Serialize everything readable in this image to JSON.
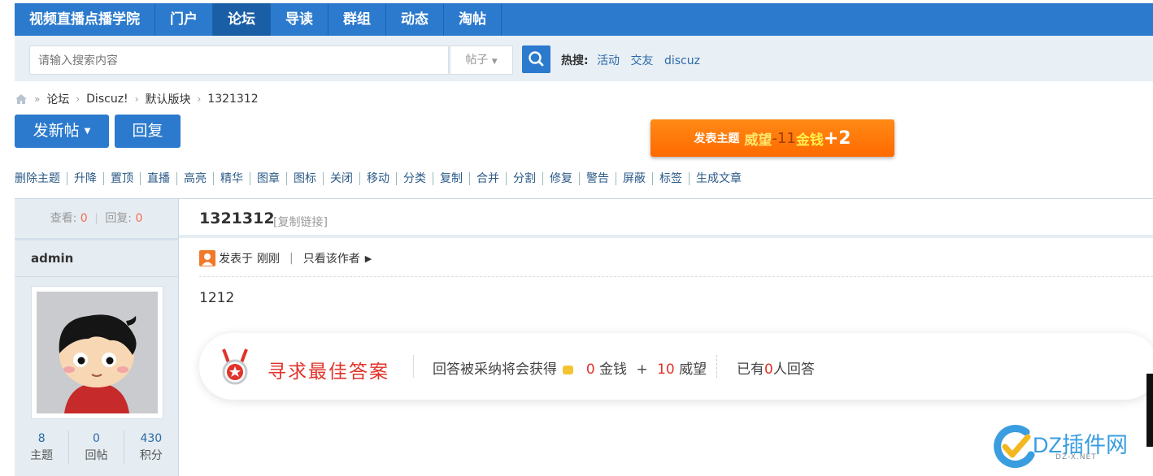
{
  "nav": {
    "site": "视频直播点播学院",
    "items": [
      "门户",
      "论坛",
      "导读",
      "群组",
      "动态",
      "淘帖"
    ],
    "active": 1
  },
  "search": {
    "placeholder": "请输入搜索内容",
    "type": "帖子",
    "hot_label": "热搜:",
    "hot": [
      "活动",
      "交友",
      "discuz"
    ]
  },
  "breadcrumb": [
    "论坛",
    "Discuz!",
    "默认版块",
    "1321312"
  ],
  "buttons": {
    "new_post": "发新帖",
    "reply": "回复"
  },
  "promo": {
    "pre": "发表主题",
    "w": "威望",
    "n1": "-11",
    "m": "金钱",
    "n2": "+2"
  },
  "mod_actions": [
    "删除主题",
    "升降",
    "置顶",
    "直播",
    "高亮",
    "精华",
    "图章",
    "图标",
    "关闭",
    "移动",
    "分类",
    "复制",
    "合并",
    "分割",
    "修复",
    "警告",
    "屏蔽",
    "标签",
    "生成文章"
  ],
  "thread": {
    "views_label": "查看:",
    "views": "0",
    "replies_label": "回复:",
    "replies": "0",
    "title": "1321312",
    "copy_link": "[复制链接]"
  },
  "post": {
    "author": "admin",
    "posted": "发表于",
    "time": "刚刚",
    "only_author": "只看该作者",
    "content": "1212",
    "stats": [
      {
        "value": "8",
        "label": "主题"
      },
      {
        "value": "0",
        "label": "回帖"
      },
      {
        "value": "430",
        "label": "积分"
      }
    ]
  },
  "bounty": {
    "title": "寻求最佳答案",
    "desc_pre": "回答被采纳将会获得",
    "money": "0",
    "money_label": "金钱",
    "plus": "+",
    "prestige": "10",
    "prestige_label": "威望",
    "count_pre": "已有",
    "count": "0",
    "count_post": "人回答"
  },
  "watermark": {
    "text": "DZ插件网",
    "sub": "DZ-X.NET"
  },
  "colors": {
    "primary": "#2b7acd",
    "accent_red": "#e0332a",
    "promo_orange": "#ff7a0a"
  }
}
